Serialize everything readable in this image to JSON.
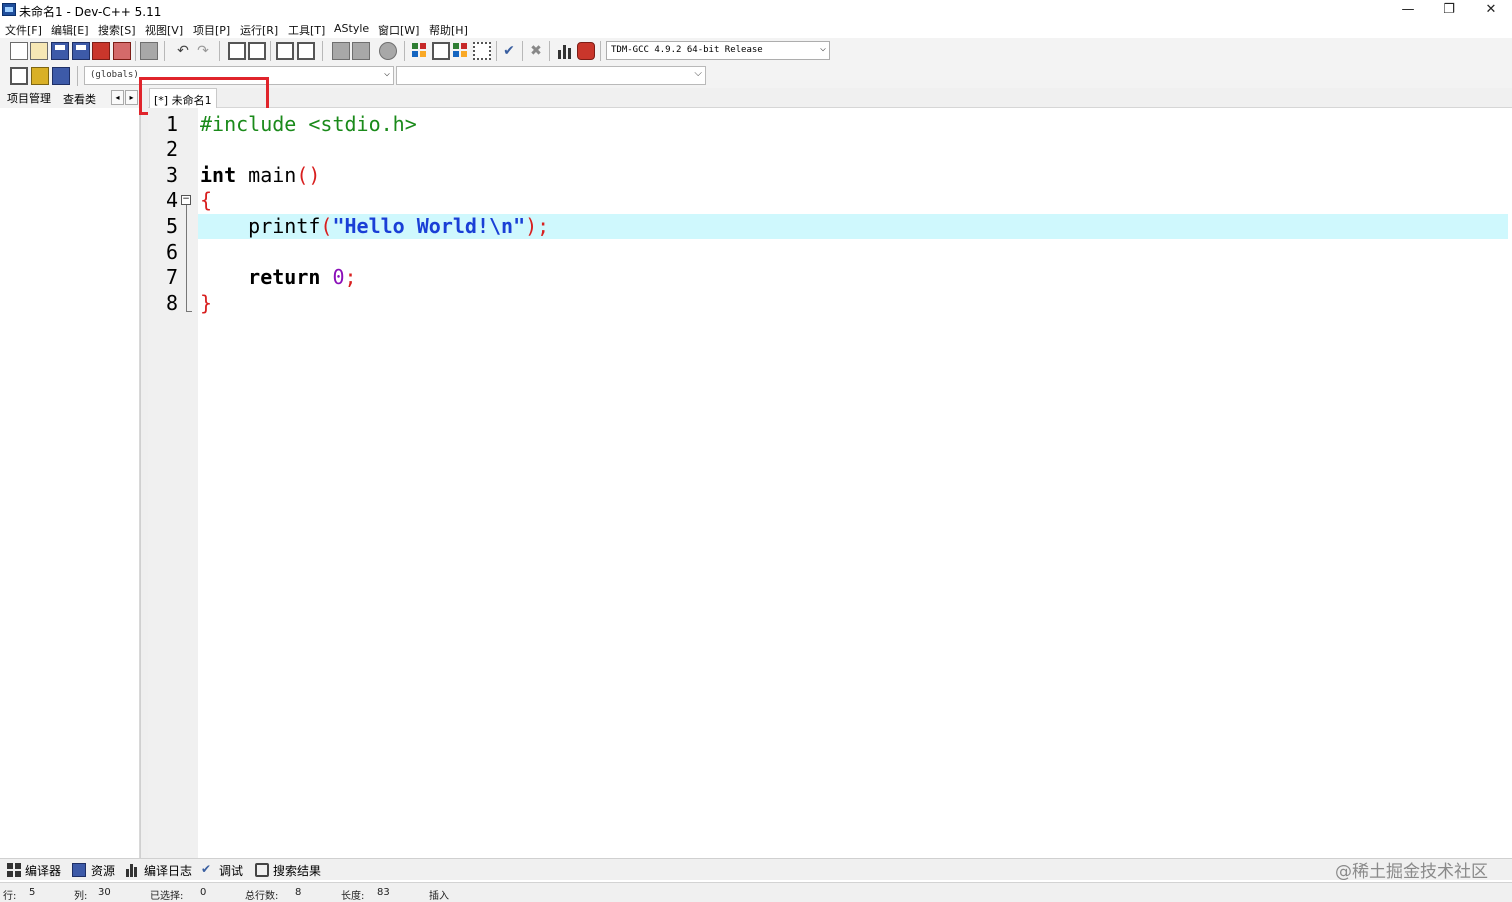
{
  "window": {
    "title": "未命名1 - Dev-C++ 5.11",
    "minimize": "—",
    "restore": "❐",
    "close": "✕"
  },
  "menu": [
    "文件[F]",
    "编辑[E]",
    "搜索[S]",
    "视图[V]",
    "项目[P]",
    "运行[R]",
    "工具[T]",
    "AStyle",
    "窗口[W]",
    "帮助[H]"
  ],
  "toolbar": {
    "compiler": "TDM-GCC 4.9.2 64-bit Release",
    "scope_combo": "(globals)"
  },
  "left_panel": {
    "tabs": [
      "项目管理",
      "查看类"
    ]
  },
  "editor": {
    "tab_label": "[*] 未命名1",
    "line_numbers": [
      "1",
      "2",
      "3",
      "4",
      "5",
      "6",
      "7",
      "8"
    ],
    "code": {
      "l1": "#include <stdio.h>",
      "l3_kw": "int",
      "l3_rest": " main",
      "l3_br": "()",
      "l4_br": "{",
      "l5_fn": "    printf",
      "l5_br1": "(",
      "l5_str": "\"Hello World!\\n\"",
      "l5_br2": ");",
      "l7_kw": "    return",
      "l7_num": " 0",
      "l7_semi": ";",
      "l8_br": "}"
    },
    "active_line_color": "#cff8fd"
  },
  "bottom_tabs": [
    "编译器",
    "资源",
    "编译日志",
    "调试",
    "搜索结果"
  ],
  "watermark": "@稀土掘金技术社区",
  "status": {
    "row_label": "行:",
    "row": "5",
    "col_label": "列:",
    "col": "30",
    "sel_label": "已选择:",
    "sel": "0",
    "lines_label": "总行数:",
    "lines": "8",
    "len_label": "长度:",
    "len": "83",
    "mode": "插入"
  },
  "colors": {
    "highlight_box": "#e0242b",
    "preprocessor": "#1a8a1a",
    "string": "#1a3fd6",
    "bracket": "#d81f1f",
    "number": "#8a0fb8"
  }
}
